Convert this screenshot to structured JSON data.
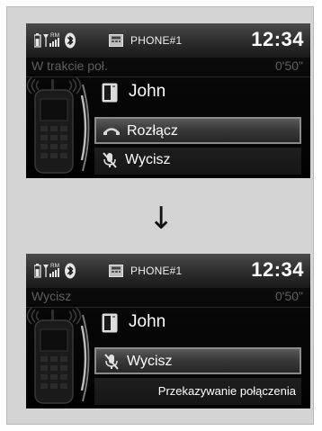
{
  "screens": [
    {
      "status": {
        "source_label": "PHONE#1",
        "clock": "12:34",
        "roaming": "RM"
      },
      "call": {
        "state": "W trakcie poł.",
        "duration": "0'50\""
      },
      "contact": {
        "name": "John"
      },
      "menu": [
        {
          "label": "Rozłącz",
          "icon": "hang-up-icon",
          "selected": true
        },
        {
          "label": "Wycisz",
          "icon": "mute-mic-icon",
          "selected": false
        }
      ]
    },
    {
      "status": {
        "source_label": "PHONE#1",
        "clock": "12:34",
        "roaming": "RM"
      },
      "call": {
        "state": "Wycisz",
        "duration": "0'50\""
      },
      "contact": {
        "name": "John"
      },
      "menu": [
        {
          "label": "Wycisz",
          "icon": "mute-mic-icon",
          "selected": true
        },
        {
          "label": "Przekazywanie połączenia",
          "selected": false
        }
      ]
    }
  ],
  "transition_arrow": "↓",
  "colors": {
    "screen_bg": "#050505",
    "statusbar_bg": "#2c2c2c",
    "selected_border": "#8a8a8a",
    "dim_text": "#5e5e5e",
    "panel_bg": "#d4d4d4"
  }
}
